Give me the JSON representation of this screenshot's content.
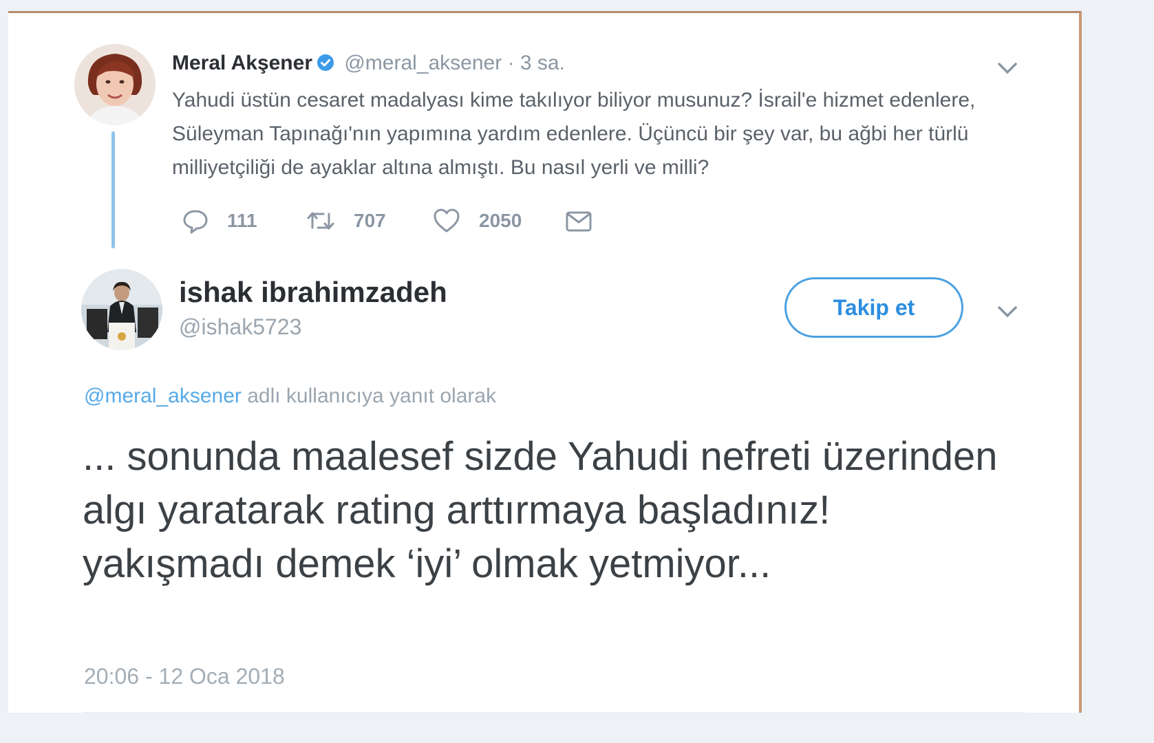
{
  "parent_tweet": {
    "author_name": "Meral Akşener",
    "handle": "@meral_aksener",
    "time_ago": "3 sa.",
    "text": "Yahudi üstün cesaret madalyası kime takılıyor biliyor musunuz? İsrail'e hizmet edenlere, Süleyman Tapınağı'nın yapımına yardım edenlere. Üçüncü bir şey var, bu ağbi her türlü milliyetçiliği de ayaklar altına almıştı. Bu nasıl yerli ve milli?",
    "actions": {
      "replies": "111",
      "retweets": "707",
      "likes": "2050"
    }
  },
  "reply_tweet": {
    "author_name": "ishak ibrahimzadeh",
    "handle": "@ishak5723",
    "follow_label": "Takip et",
    "reply_to_mention": "@meral_aksener",
    "reply_to_suffix": " adlı kullanıcıya yanıt olarak",
    "text": "... sonunda maalesef sizde Yahudi nefreti üzerinden algı yaratarak rating arttırmaya başladınız! yakışmadı demek ‘iyi’ olmak yetmiyor...",
    "timestamp": "20:06 - 12 Oca 2018"
  },
  "colors": {
    "accent": "#2c8ee0",
    "thread_line": "#8fc3ec",
    "muted_text": "#8b97a3"
  },
  "icons": [
    "reply-icon",
    "retweet-icon",
    "like-icon",
    "message-icon",
    "verified-badge-icon",
    "chevron-down-icon"
  ]
}
